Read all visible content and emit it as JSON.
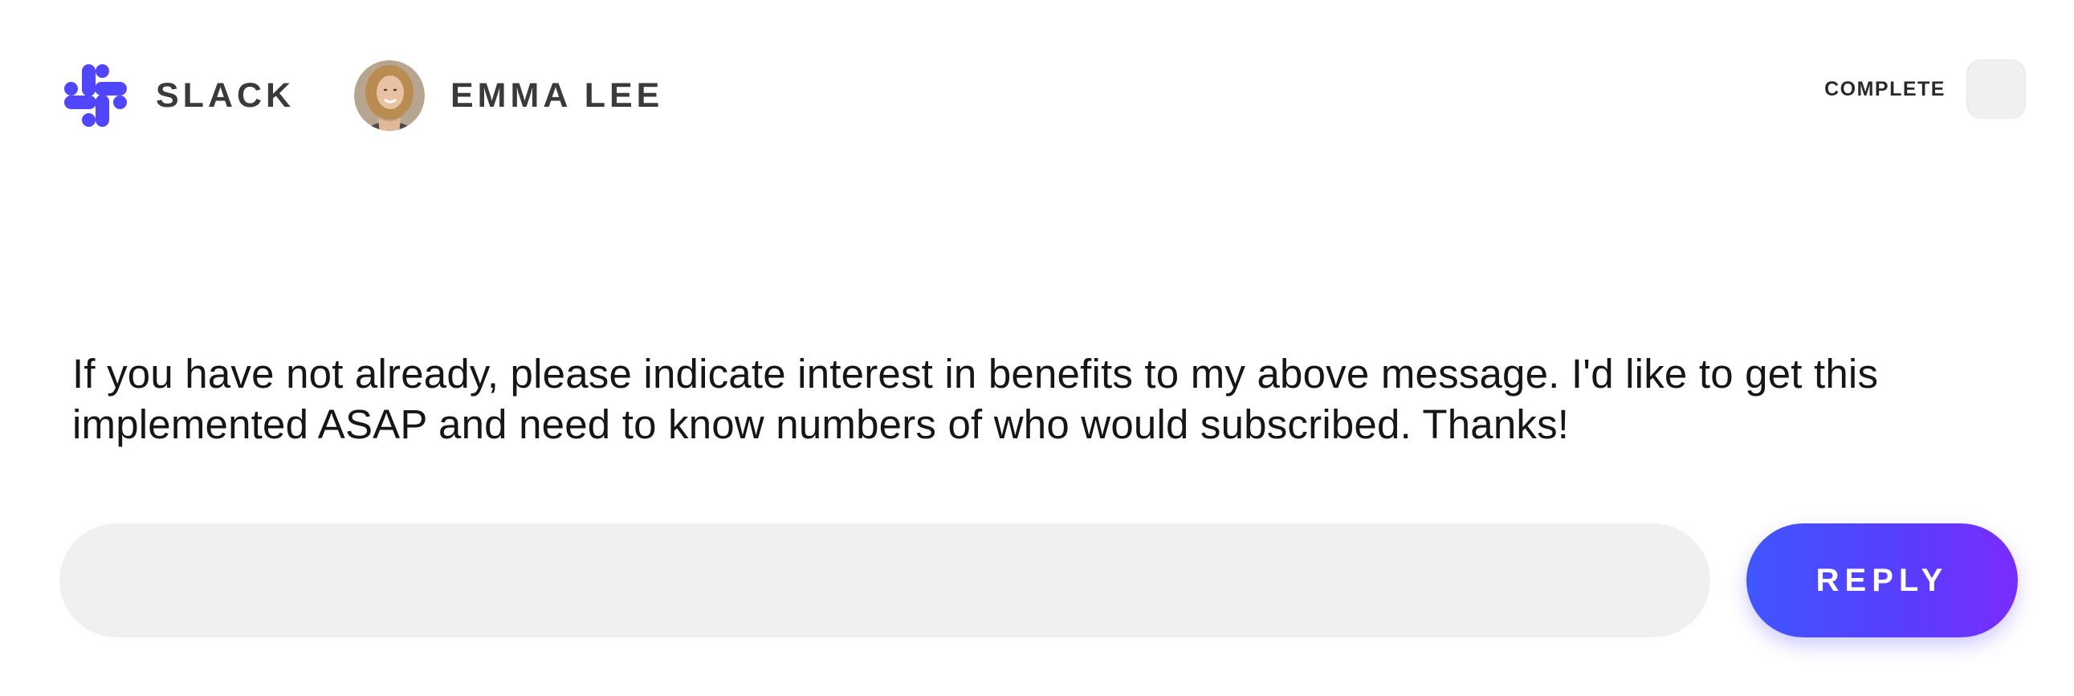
{
  "header": {
    "app": {
      "name": "SLACK",
      "icon": "slack-logo-icon",
      "logo_color": "#5046ff"
    },
    "sender": {
      "name": "EMMA LEE",
      "avatar": "user-avatar"
    },
    "complete": {
      "label": "COMPLETE",
      "checked": false
    }
  },
  "message": {
    "text": "If you have not already, please indicate interest in benefits to my above message. I'd like to get this implemented ASAP and need to know numbers of who would subscribed. Thanks!"
  },
  "reply": {
    "input_value": "",
    "input_placeholder": "",
    "button_label": "REPLY",
    "button_gradient": [
      "#3f56ff",
      "#7a2cff"
    ]
  }
}
